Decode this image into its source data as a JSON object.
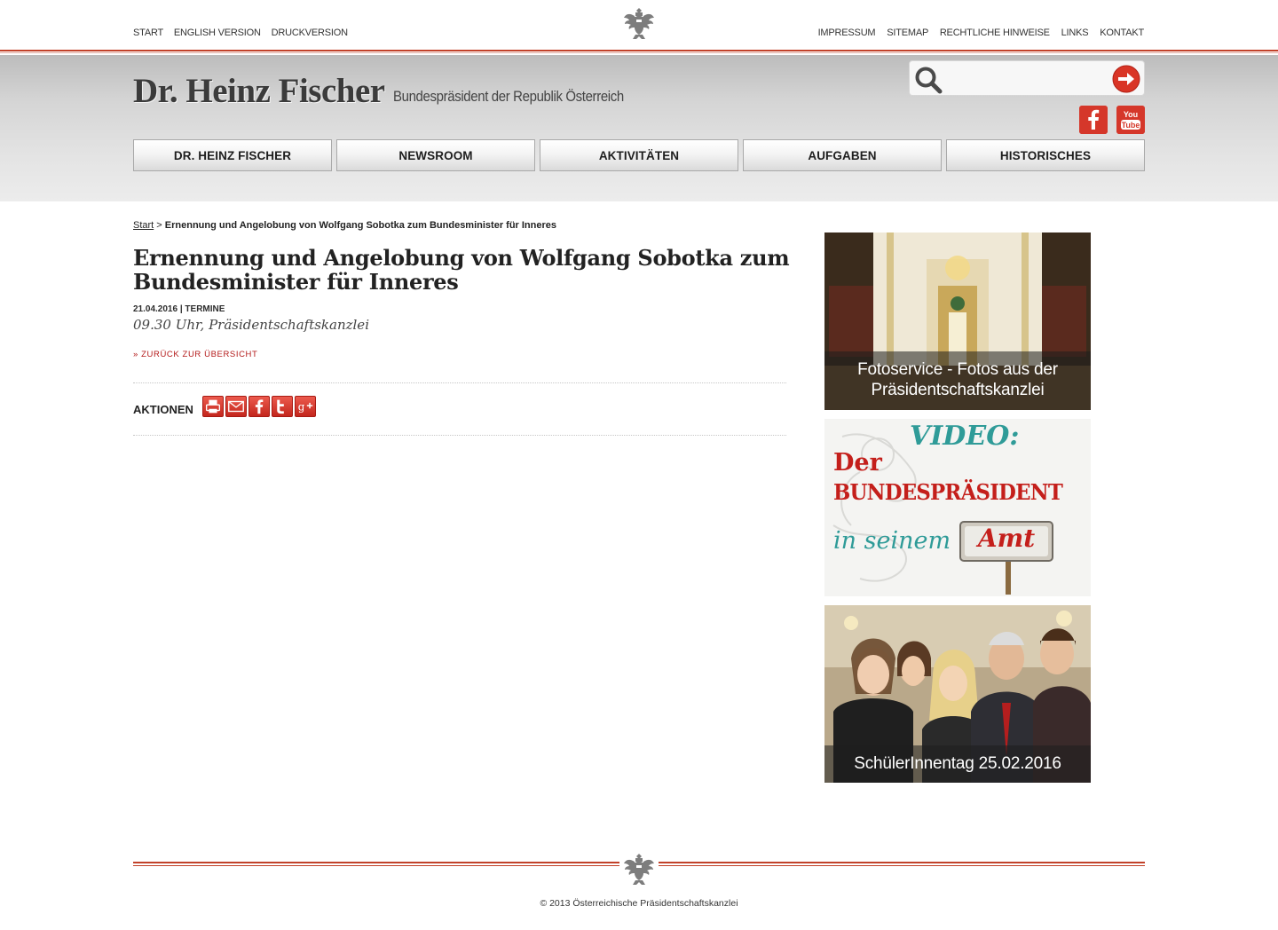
{
  "top_nav": {
    "left": [
      "START",
      "ENGLISH VERSION",
      "DRUCKVERSION"
    ],
    "right": [
      "IMPRESSUM",
      "SITEMAP",
      "RECHTLICHE HINWEISE",
      "LINKS",
      "KONTAKT"
    ]
  },
  "header": {
    "title": "Dr. Heinz Fischer",
    "subtitle": "Bundespräsident der Republik Österreich",
    "search_placeholder": ""
  },
  "main_nav": [
    "DR. HEINZ FISCHER",
    "NEWSROOM",
    "AKTIVITÄTEN",
    "AUFGABEN",
    "HISTORISCHES"
  ],
  "breadcrumb": {
    "home": "Start",
    "separator": " > ",
    "current": "Ernennung und Angelobung von Wolfgang Sobotka zum Bundesminister für Inneres"
  },
  "article": {
    "title": "Ernennung und Angelobung von Wolfgang Sobotka zum Bundesminister für Inneres",
    "date": "21.04.2016",
    "meta_sep": " | ",
    "category": "TERMINE",
    "time_place": "09.30 Uhr, Präsidentschaftskanzlei",
    "back_link": "» ZURÜCK ZUR ÜBERSICHT",
    "actions_label": "AKTIONEN"
  },
  "sidebar": {
    "teaser1": "Fotoservice - Fotos aus der Präsidentschaftskanzlei",
    "teaser2": {
      "line1": "VIDEO:",
      "line2": "Der",
      "line3": "BUNDESPRÄSIDENT",
      "line4": "in seinem",
      "sign": "Amt"
    },
    "teaser3": "SchülerInnentag 25.02.2016"
  },
  "footer": {
    "copyright": "© 2013 Österreichische Präsidentschaftskanzlei"
  },
  "colors": {
    "accent_red": "#c24129",
    "link_red": "#b31818"
  }
}
